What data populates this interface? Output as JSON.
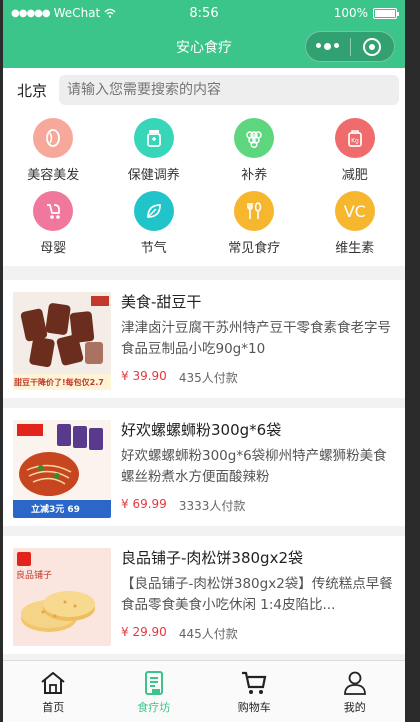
{
  "status": {
    "carrier": "WeChat",
    "time": "8:56",
    "battery": "100%"
  },
  "nav": {
    "title": "安心食疗"
  },
  "search": {
    "city": "北京",
    "placeholder": "请输入您需要搜索的内容"
  },
  "categories": [
    {
      "label": "美容美发",
      "icon": "face-icon",
      "color": "#f6a99a"
    },
    {
      "label": "保健调养",
      "icon": "medicine-bottle-icon",
      "color": "#38d6b9"
    },
    {
      "label": "补养",
      "icon": "grapes-icon",
      "color": "#5ed67e"
    },
    {
      "label": "减肥",
      "icon": "weight-bag-icon",
      "color": "#f06b6b"
    },
    {
      "label": "母婴",
      "icon": "stroller-icon",
      "color": "#f0789c"
    },
    {
      "label": "节气",
      "icon": "leaf-icon",
      "color": "#20c4c9"
    },
    {
      "label": "常见食疗",
      "icon": "fork-spoon-icon",
      "color": "#f6b62d"
    },
    {
      "label": "维生素",
      "icon": "vitamin-c-icon",
      "color": "#f6b62d",
      "text": "VC"
    }
  ],
  "products": [
    {
      "name": "美食-甜豆干",
      "desc": "津津卤汁豆腐干苏州特产豆干零食素食老字号食品豆制品小吃90g*10",
      "price": "¥ 39.90",
      "sold": "435人付款",
      "banner": "甜豆干降价了!每包仅2.7"
    },
    {
      "name": "好欢螺螺蛳粉300g*6袋",
      "desc": "好欢螺螺蛳粉300g*6袋柳州特产螺狮粉美食螺丝粉煮水方便面酸辣粉",
      "price": "¥ 69.99",
      "sold": "3333人付款",
      "banner": "立减3元 69"
    },
    {
      "name": "良品铺子-肉松饼380gx2袋",
      "desc": "【良品铺子-肉松饼380gx2袋】传统糕点早餐食品零食美食小吃休闲 1:4皮陷比...",
      "price": "¥ 29.90",
      "sold": "445人付款",
      "banner": "良品铺子"
    }
  ],
  "tabs": [
    {
      "label": "首页",
      "icon": "home-icon"
    },
    {
      "label": "食疗坊",
      "icon": "recipe-book-icon",
      "active": true
    },
    {
      "label": "购物车",
      "icon": "cart-icon"
    },
    {
      "label": "我的",
      "icon": "user-icon"
    }
  ],
  "colors": {
    "brand": "#3cc58a",
    "price": "#e4393c"
  }
}
